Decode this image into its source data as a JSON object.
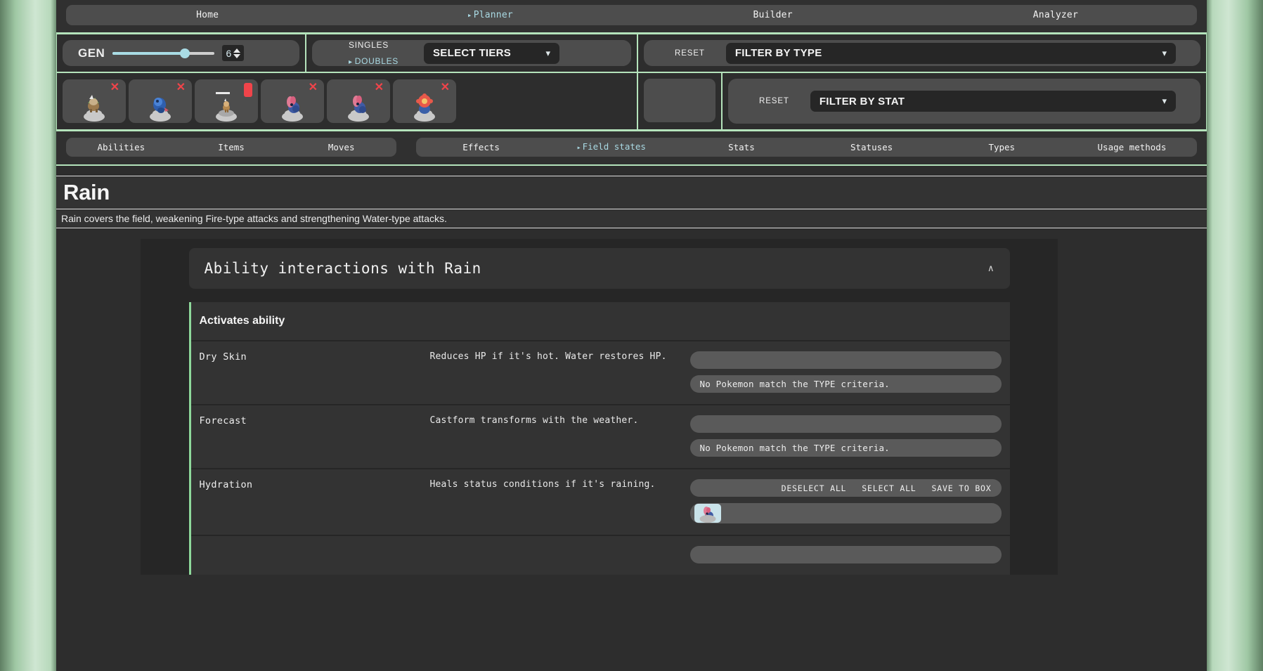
{
  "nav": {
    "items": [
      {
        "label": "Home",
        "active": false
      },
      {
        "label": "Planner",
        "active": true
      },
      {
        "label": "Builder",
        "active": false
      },
      {
        "label": "Analyzer",
        "active": false
      }
    ]
  },
  "controls": {
    "gen": {
      "label": "GEN",
      "value": "6",
      "min": 1,
      "max": 9
    },
    "format": {
      "modes": [
        {
          "label": "SINGLES",
          "selected": false
        },
        {
          "label": "DOUBLES",
          "selected": true
        }
      ],
      "tiers_select": "SELECT TIERS"
    },
    "type_filter": {
      "reset_label": "RESET",
      "select": "FILTER BY TYPE"
    },
    "stat_filter": {
      "reset_label": "RESET",
      "select": "FILTER BY STAT"
    }
  },
  "team": {
    "slots": [
      {
        "name": "slot-1",
        "remove": "✕",
        "state": "filled",
        "body": "#8a7456",
        "accent": "#e8e8e8"
      },
      {
        "name": "slot-2",
        "remove": "✕",
        "state": "filled",
        "body": "#3f69b8",
        "accent": "#6ea0e0"
      },
      {
        "name": "slot-3",
        "remove": "",
        "state": "hovered",
        "body": "#b08a50",
        "accent": "#e0c090"
      },
      {
        "name": "slot-4",
        "remove": "✕",
        "state": "filled",
        "body": "#4b5e9e",
        "accent": "#e0708a"
      },
      {
        "name": "slot-5",
        "remove": "✕",
        "state": "filled",
        "body": "#4b5e9e",
        "accent": "#e07a94"
      },
      {
        "name": "slot-6",
        "remove": "✕",
        "state": "filled",
        "body": "#3a5fa8",
        "accent": "#e8594a"
      }
    ]
  },
  "filter_tabs": {
    "left": [
      {
        "label": "Abilities",
        "active": false
      },
      {
        "label": "Items",
        "active": false
      },
      {
        "label": "Moves",
        "active": false
      }
    ],
    "right": [
      {
        "label": "Effects",
        "active": false
      },
      {
        "label": "Field states",
        "active": true
      },
      {
        "label": "Stats",
        "active": false
      },
      {
        "label": "Statuses",
        "active": false
      },
      {
        "label": "Types",
        "active": false
      },
      {
        "label": "Usage methods",
        "active": false
      }
    ]
  },
  "entity": {
    "title": "Rain",
    "description": "Rain covers the field, weakening Fire-type attacks and strengthening Water-type attacks."
  },
  "accordion": {
    "title": "Ability interactions with Rain",
    "caret": "∧",
    "expanded": true
  },
  "section": {
    "heading": "Activates ability",
    "rows": [
      {
        "name": "Dry Skin",
        "desc": "Reduces HP if it's hot. Water restores HP.",
        "result_type": "empty-then-message",
        "message": "No Pokemon match the TYPE criteria."
      },
      {
        "name": "Forecast",
        "desc": "Castform transforms with the weather.",
        "result_type": "empty-then-message",
        "message": "No Pokemon match the TYPE criteria."
      },
      {
        "name": "Hydration",
        "desc": "Heals status conditions if it's raining.",
        "result_type": "actions-then-members",
        "actions": [
          "DESELECT ALL",
          "SELECT ALL",
          "SAVE TO BOX"
        ],
        "members": [
          {
            "name": "member-1",
            "body": "#4b5e9e",
            "accent": "#e0708a"
          }
        ]
      }
    ]
  },
  "colors": {
    "accent_green": "#b4e3bb",
    "accent_blue": "#a9d9e3",
    "danger_red": "#f0444a",
    "panel": "#4d4d4d",
    "page_bg": "#2d2d2d"
  }
}
